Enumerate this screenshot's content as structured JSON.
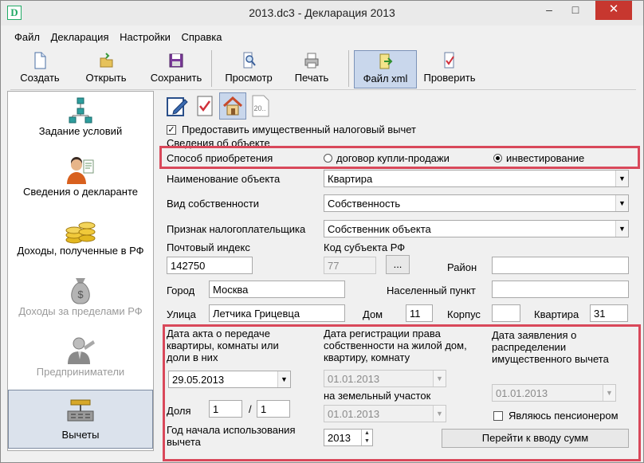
{
  "window": {
    "title": "2013.dc3 - Декларация 2013",
    "app_icon": "D",
    "minimize": "–",
    "maximize": "□",
    "close": "✕"
  },
  "menu": [
    "Файл",
    "Декларация",
    "Настройки",
    "Справка"
  ],
  "toolbar": {
    "create": "Создать",
    "open": "Открыть",
    "save": "Сохранить",
    "preview": "Просмотр",
    "print": "Печать",
    "xml": "Файл xml",
    "check": "Проверить"
  },
  "sidebar": [
    {
      "label": "Задание условий",
      "icon": "network-icon",
      "state": "normal"
    },
    {
      "label": "Сведения о декларанте",
      "icon": "person-icon",
      "state": "normal"
    },
    {
      "label": "Доходы, полученные в РФ",
      "icon": "coins-icon",
      "state": "normal"
    },
    {
      "label": "Доходы за пределами РФ",
      "icon": "money-bag-icon",
      "state": "disabled"
    },
    {
      "label": "Предприниматели",
      "icon": "businessman-icon",
      "state": "disabled"
    },
    {
      "label": "Вычеты",
      "icon": "deductions-icon",
      "state": "active"
    }
  ],
  "form": {
    "provide_deduction": {
      "label": "Предоставить имущественный налоговый вычет",
      "checked": true
    },
    "section_title": "Сведения об объекте",
    "acquisition": {
      "label": "Способ приобретения",
      "option1": "договор купли-продажи",
      "option2": "инвестирование",
      "selected": "инвестирование"
    },
    "object_name": {
      "label": "Наименование объекта",
      "value": "Квартира"
    },
    "ownership": {
      "label": "Вид собственности",
      "value": "Собственность"
    },
    "taxpayer_sign": {
      "label": "Признак налогоплательщика",
      "value": "Собственник объекта"
    },
    "postal_code": {
      "label": "Почтовый индекс",
      "value": "142750"
    },
    "region_code": {
      "label": "Код субъекта РФ",
      "value": "77",
      "button": "..."
    },
    "district": {
      "label": "Район",
      "value": ""
    },
    "city": {
      "label": "Город",
      "value": "Москва"
    },
    "locality": {
      "label": "Населенный пункт",
      "value": ""
    },
    "street": {
      "label": "Улица",
      "value": "Летчика Грицевца"
    },
    "house": {
      "label": "Дом",
      "value": "11"
    },
    "building": {
      "label": "Корпус",
      "value": ""
    },
    "apartment": {
      "label": "Квартира",
      "value": "31"
    },
    "transfer_act_date": {
      "label": "Дата акта о передаче квартиры, комнаты или доли в них",
      "value": "29.05.2013"
    },
    "registration_date": {
      "label": "Дата регистрации права собственности на жилой дом, квартиру, комнату",
      "value": "01.01.2013"
    },
    "land_label": "на земельный участок",
    "land_date": "01.01.2013",
    "application_date": {
      "label": "Дата заявления о распределении имущественного вычета",
      "value": "01.01.2013"
    },
    "share": {
      "label": "Доля",
      "numerator": "1",
      "separator": "/",
      "denominator": "1"
    },
    "pensioner": {
      "label": "Являюсь пенсионером",
      "checked": false
    },
    "start_year": {
      "label": "Год начала использования вычета",
      "value": "2013"
    },
    "goto_button": "Перейти к вводу сумм"
  },
  "colors": {
    "highlight_box": "#d9485a",
    "active_bg": "#c9d7ec",
    "close_button": "#c7372f"
  }
}
